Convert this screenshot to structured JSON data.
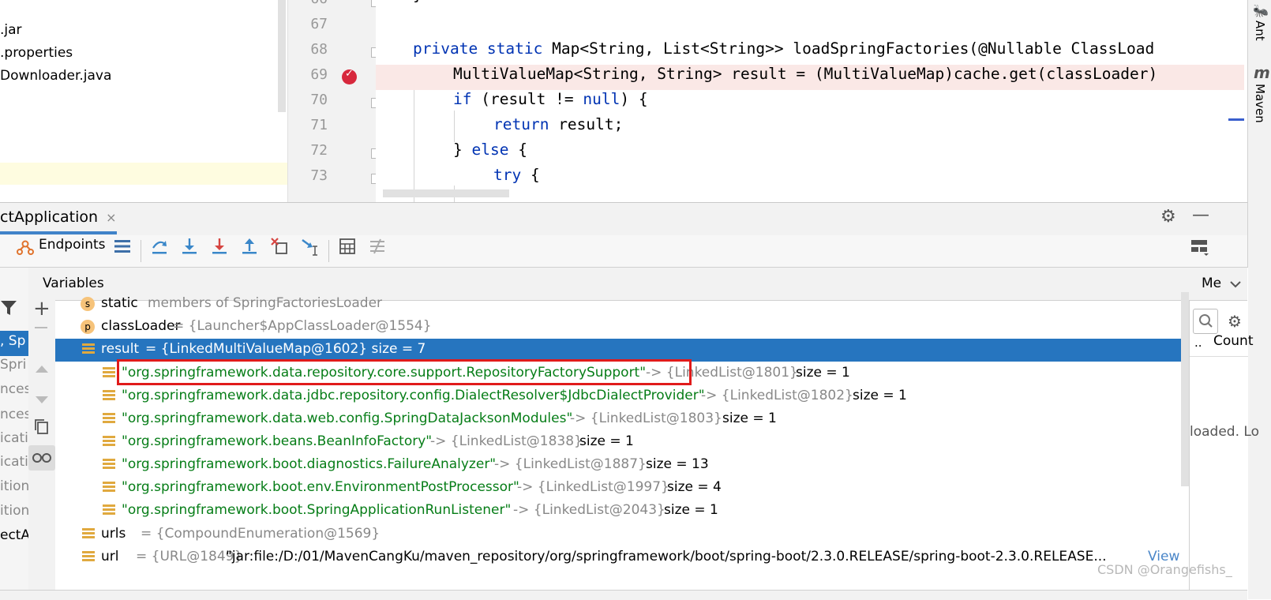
{
  "project_tree": {
    "files": [
      ".jar",
      ".properties",
      "Downloader.java"
    ]
  },
  "editor": {
    "line_numbers": [
      "66",
      "67",
      "68",
      "69",
      "70",
      "71",
      "72",
      "73"
    ],
    "lines": {
      "l66": "}",
      "l68_kw": "private static",
      "l68_rest": " Map<String, List<String>> loadSpringFactories(@Nullable ClassLoad",
      "l69": "MultiValueMap<String, String> result = (MultiValueMap)cache.get(classLoader)",
      "l70_kw": "if",
      "l70_a": " (result != ",
      "l70_null": "null",
      "l70_b": ") {",
      "l71_kw": "return",
      "l71_rest": " result;",
      "l72_a": "} ",
      "l72_kw": "else",
      "l72_b": " {",
      "l73_kw": "try",
      "l73_rest": " {"
    }
  },
  "right_strip": {
    "ant": "Ant",
    "maven_letter": "m",
    "maven": "Maven"
  },
  "debug": {
    "tab_title": "ctApplication",
    "tab_close": "×",
    "endpoints_label": "Endpoints",
    "variables_label": "Variables",
    "memory_tab": "Me",
    "count_header": "Count",
    "count_dots": "..",
    "loaded_text": "loaded. Lo",
    "frames": [
      ", Sp",
      "Spri",
      "nces",
      "nces",
      "icati",
      "icati",
      "ition",
      "ition",
      "ectA"
    ]
  },
  "variables": [
    {
      "name": "static",
      "value": "members of SpringFactoriesLoader",
      "icon": "s",
      "expandable": true
    },
    {
      "name": "classLoader",
      "value": "= {Launcher$AppClassLoader@1554}",
      "icon": "p",
      "expandable": true
    },
    {
      "name": "result",
      "value": "= {LinkedMultiValueMap@1602}  size = 7",
      "icon": "field",
      "expanded": true,
      "selected": true
    }
  ],
  "result_entries": [
    {
      "key": "\"org.springframework.data.repository.core.support.RepositoryFactorySupport\"",
      "ref": "-> {LinkedList@1801}",
      "size": "size = 1"
    },
    {
      "key": "\"org.springframework.data.jdbc.repository.config.DialectResolver$JdbcDialectProvider\"",
      "ref": "-> {LinkedList@1802}",
      "size": "size = 1"
    },
    {
      "key": "\"org.springframework.data.web.config.SpringDataJacksonModules\"",
      "ref": "-> {LinkedList@1803}",
      "size": "size = 1"
    },
    {
      "key": "\"org.springframework.beans.BeanInfoFactory\"",
      "ref": "-> {LinkedList@1838}",
      "size": "size = 1"
    },
    {
      "key": "\"org.springframework.boot.diagnostics.FailureAnalyzer\"",
      "ref": "-> {LinkedList@1887}",
      "size": "size = 13"
    },
    {
      "key": "\"org.springframework.boot.env.EnvironmentPostProcessor\"",
      "ref": "-> {LinkedList@1997}",
      "size": "size = 4"
    },
    {
      "key": "\"org.springframework.boot.SpringApplicationRunListener\"",
      "ref": "-> {LinkedList@2043}",
      "size": "size = 1"
    }
  ],
  "tail_vars": [
    {
      "name": "urls",
      "value": "= {CompoundEnumeration@1569}"
    },
    {
      "name": "url",
      "value": "= {URL@1849}",
      "string": "\"jar:file:/D:/01/MavenCangKu/maven_repository/org/springframework/boot/spring-boot/2.3.0.RELEASE/spring-boot-2.3.0.RELEASE...",
      "view": "View"
    }
  ],
  "watermark": "CSDN @Orangefishs_",
  "colors": {
    "selection": "#2675bf",
    "string": "#067d17",
    "keyword": "#0033b3",
    "breakpoint": "#d7283d",
    "highlight_box": "#e01b1b"
  },
  "icons": [
    "settings-gear-icon",
    "minimize-icon",
    "endpoints-icon",
    "frames-icon",
    "step-over-icon",
    "step-into-icon",
    "force-step-into-icon",
    "step-out-icon",
    "drop-frame-icon",
    "run-to-cursor-icon",
    "evaluate-icon",
    "trace-icon",
    "layout-icon",
    "filter-icon",
    "add-watch-icon",
    "remove-icon",
    "up-icon",
    "down-icon",
    "copy-icon",
    "glasses-icon",
    "search-icon",
    "breakpoint-icon"
  ]
}
